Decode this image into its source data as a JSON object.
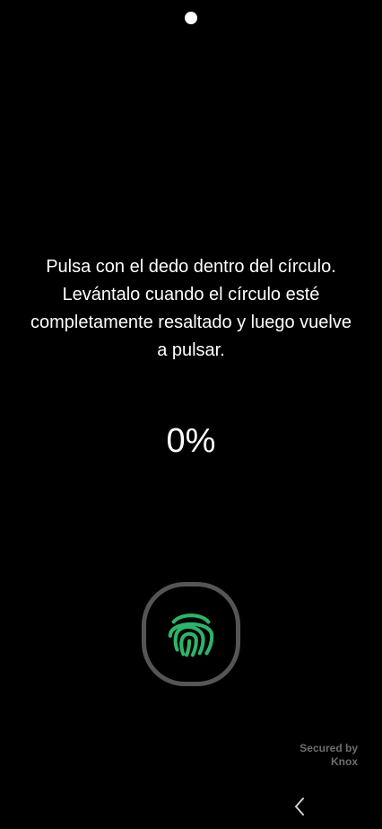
{
  "instruction": {
    "text": "Pulsa con el dedo dentro del círculo.\nLevántalo cuando el círculo esté\ncompletamente resaltado y luego vuelve\na pulsar."
  },
  "progress": {
    "label": "0%",
    "value": 0
  },
  "sensor": {
    "icon": "fingerprint-icon",
    "icon_color": "#2fb36a",
    "ring_color": "#555555"
  },
  "branding": {
    "line1": "Secured by",
    "line2": "Knox"
  },
  "navigation": {
    "back_icon": "chevron-left-icon"
  }
}
